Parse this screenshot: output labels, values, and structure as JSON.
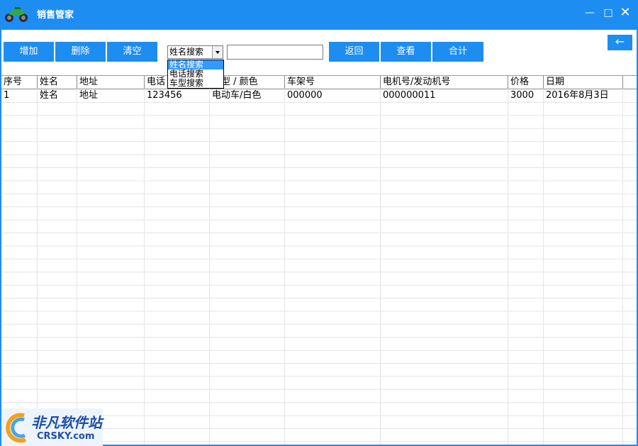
{
  "window": {
    "title": "销售管家",
    "icon": "motorcycle-icon",
    "controls": {
      "minimize": "—",
      "maximize": "□",
      "close": "✕"
    }
  },
  "toolbar": {
    "add_label": "增加",
    "delete_label": "删除",
    "clear_label": "清空",
    "search_mode": "姓名搜索",
    "search_value": "",
    "back_label": "返回",
    "view_label": "查看",
    "sum_label": "合计",
    "nav_arrow": "←"
  },
  "dropdown": {
    "options": [
      "姓名搜索",
      "电话搜索",
      "车型搜索"
    ],
    "selected_index": 0
  },
  "table": {
    "columns": [
      "序号",
      "姓名",
      "地址",
      "电话",
      "车型 / 颜色",
      "车架号",
      "电机号/发动机号",
      "价格",
      "日期"
    ],
    "rows": [
      [
        "1",
        "姓名",
        "地址",
        "123456",
        "电动车/白色",
        "000000",
        "000000011",
        "3000",
        "2016年8月3日"
      ]
    ]
  },
  "watermark": {
    "text_cn": "非凡软件站",
    "text_en": "CRSKY.com"
  },
  "colors": {
    "accent": "#1e8df2",
    "selection": "#3399ff",
    "grid_line": "#d9d9d9"
  }
}
